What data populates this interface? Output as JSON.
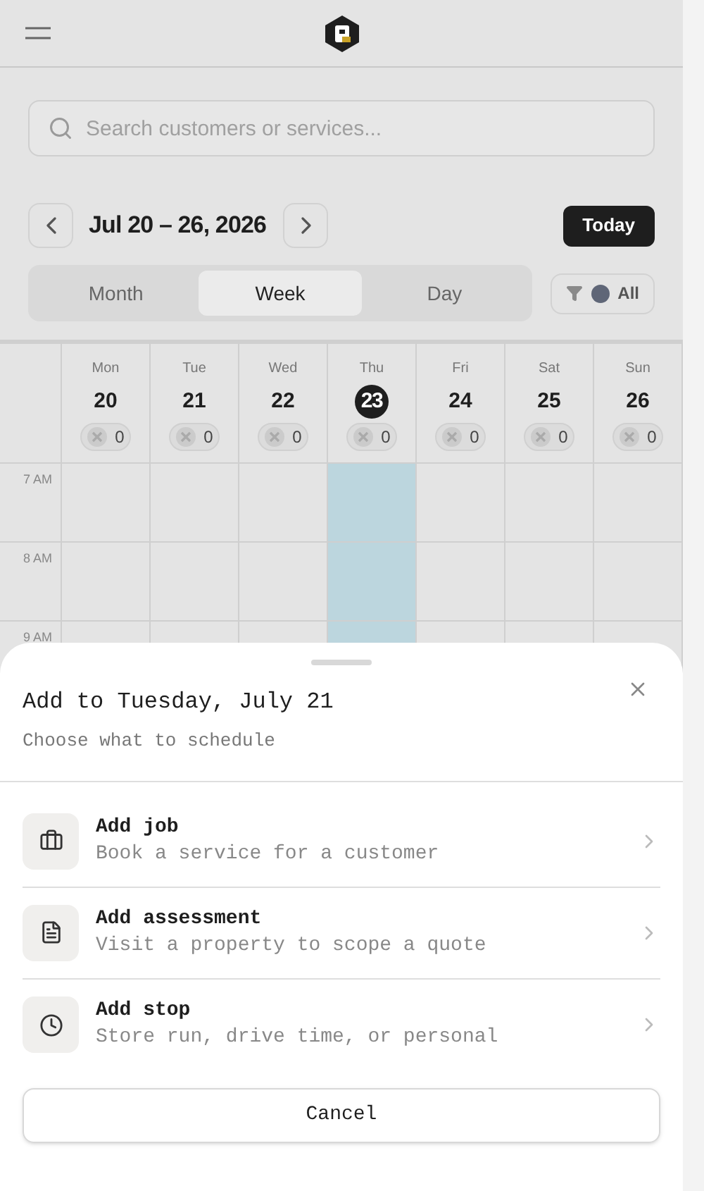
{
  "search": {
    "placeholder": "Search customers or services..."
  },
  "date_range": "Jul 20 – 26, 2026",
  "today_button": "Today",
  "view_tabs": [
    {
      "label": "Month",
      "selected": false
    },
    {
      "label": "Week",
      "selected": true
    },
    {
      "label": "Day",
      "selected": false
    }
  ],
  "filter": {
    "label": "All"
  },
  "days": [
    {
      "weekday": "Mon",
      "date": "20",
      "count": "0",
      "today": false
    },
    {
      "weekday": "Tue",
      "date": "21",
      "count": "0",
      "today": false
    },
    {
      "weekday": "Wed",
      "date": "22",
      "count": "0",
      "today": false
    },
    {
      "weekday": "Thu",
      "date": "23",
      "count": "0",
      "today": true
    },
    {
      "weekday": "Fri",
      "date": "24",
      "count": "0",
      "today": false
    },
    {
      "weekday": "Sat",
      "date": "25",
      "count": "0",
      "today": false
    },
    {
      "weekday": "Sun",
      "date": "26",
      "count": "0",
      "today": false
    }
  ],
  "hours": [
    "7 AM",
    "8 AM",
    "9 AM"
  ],
  "sheet": {
    "title": "Add to Tuesday, July 21",
    "subtitle": "Choose what to schedule",
    "options": [
      {
        "kind": "job",
        "title": "Add job",
        "description": "Book a service for a customer"
      },
      {
        "kind": "assessment",
        "title": "Add assessment",
        "description": "Visit a property to scope a quote"
      },
      {
        "kind": "stop",
        "title": "Add stop",
        "description": "Store run, drive time, or personal"
      }
    ],
    "cancel": "Cancel"
  }
}
